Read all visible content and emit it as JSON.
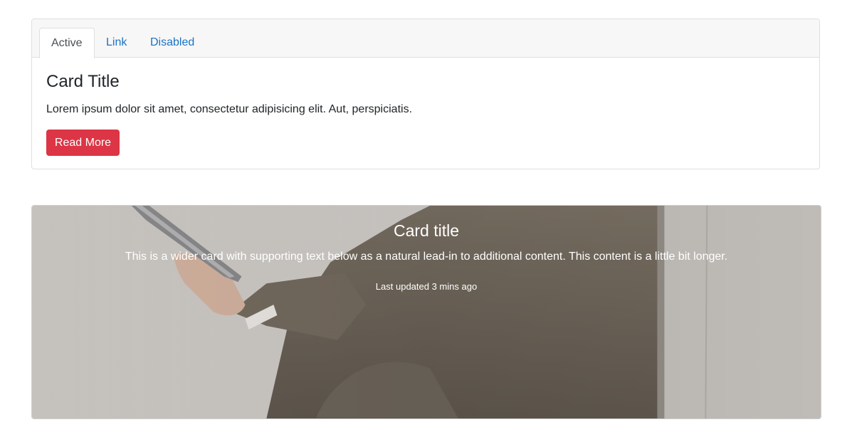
{
  "tabs_card": {
    "tabs": [
      {
        "label": "Active"
      },
      {
        "label": "Link"
      },
      {
        "label": "Disabled"
      }
    ],
    "title": "Card Title",
    "text": "Lorem ipsum dolor sit amet, consectetur adipisicing elit. Aut, perspiciatis.",
    "button_label": "Read More",
    "button_color": "#dc3545"
  },
  "overlay_card": {
    "title": "Card title",
    "text": "This is a wider card with supporting text below as a natural lead-in to additional content. This content is a little bit longer.",
    "updated": "Last updated 3 mins ago",
    "image_icon": "person-holding-phone-image"
  }
}
